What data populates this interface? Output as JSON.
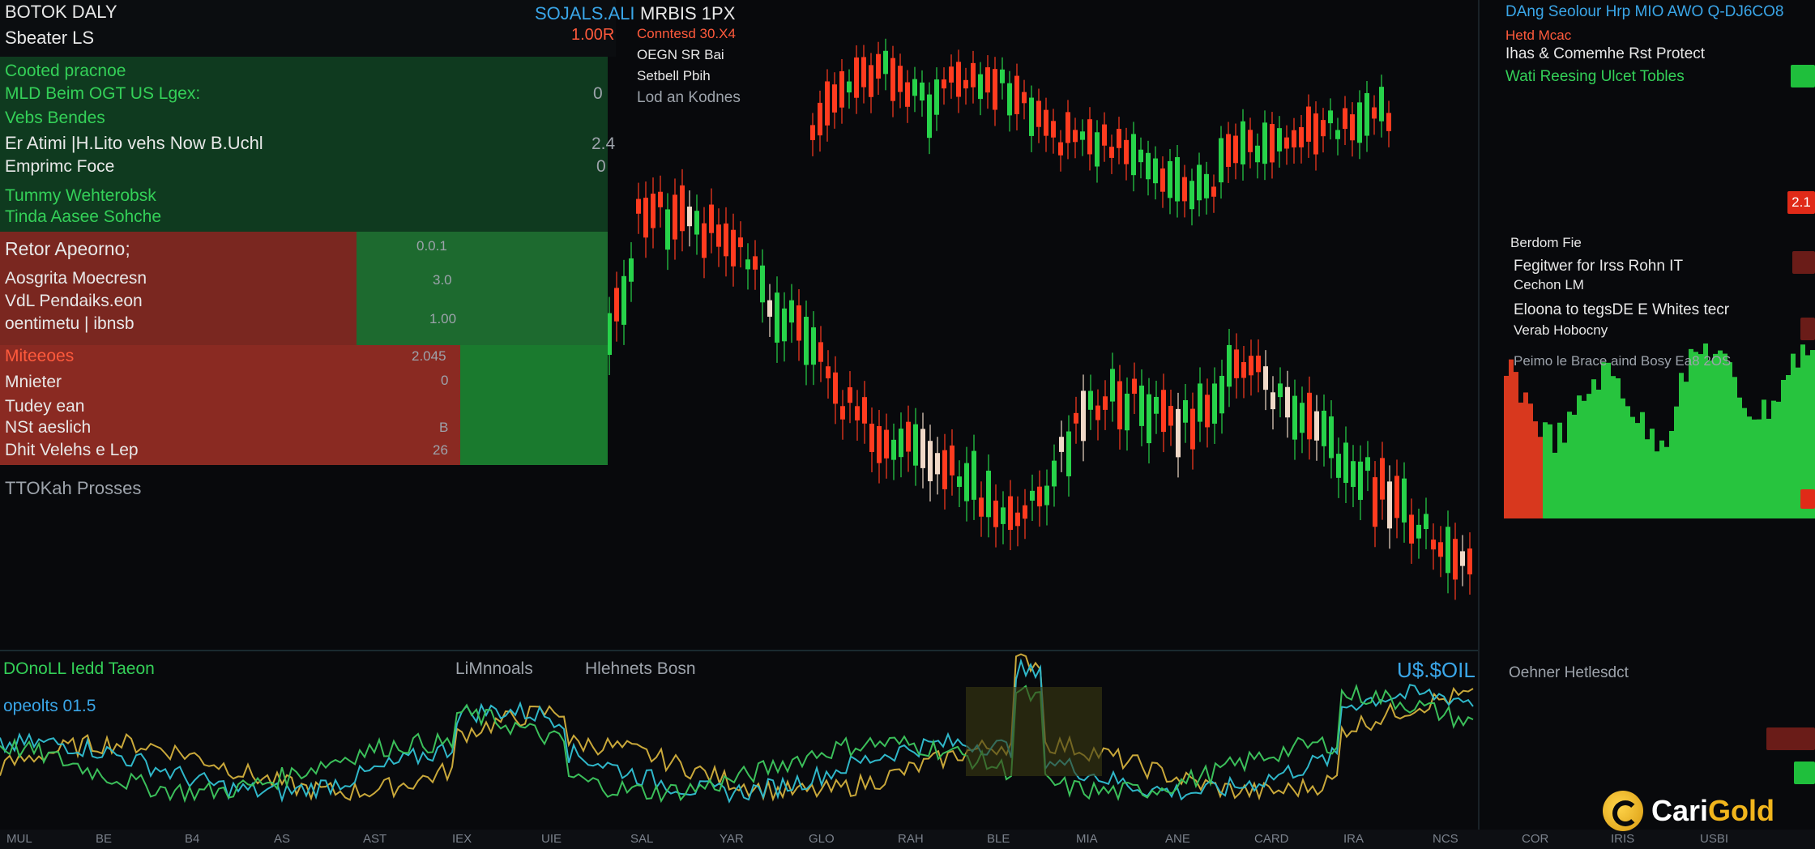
{
  "header": {
    "title": "BOTOK DALY",
    "subtitle": "Sbeater LS",
    "ticker_mid": "SOJALS.ALI",
    "ticker_mid2": "MRBIS 1PX",
    "value_top": "1.00R",
    "right_title": "DAng Seolour Hrp MIO AWO Q-DJ6CO8"
  },
  "top_info": [
    "Conntesd 30.X4",
    "OEGN SR Bai",
    "Setbell Pbih",
    "Lod an Kodnes"
  ],
  "watchlist": {
    "groups": [
      {
        "rows": [
          {
            "label": "Cooted pracnoe",
            "value": ""
          },
          {
            "label": "MLD Beim OGT US Lgex:",
            "value": "0"
          },
          {
            "label": "Vebs Bendes",
            "value": ""
          },
          {
            "label": "Er Atimi |H.Lito vehs Now B.Uchl",
            "value": "2.4"
          },
          {
            "label": "Emprimc Foce",
            "value": "0"
          },
          {
            "label": "Tummy Wehterobsk",
            "value": ""
          },
          {
            "label": "Tinda Aasee Sohche",
            "value": ""
          }
        ]
      },
      {
        "header": "Retor Apeorno;",
        "rows": [
          {
            "label": "Aosgrita Moecresn",
            "value": "3.0"
          },
          {
            "label": "VdL Pendaiks.eon",
            "value": ""
          },
          {
            "label": "oentimetu | ibnsb",
            "value": "1.00"
          }
        ],
        "header_value": "0.0.1"
      },
      {
        "header": "Miteeoes",
        "header_value": "2.045",
        "rows": [
          {
            "label": "Mnieter",
            "value": "0"
          },
          {
            "label": "Tudey ean",
            "value": ""
          },
          {
            "label": "NSt aeslich",
            "value": "B"
          },
          {
            "label": "Dhit Velehs e Lep",
            "value": "26"
          }
        ]
      }
    ],
    "footer": "TTOKah Prosses"
  },
  "right_panel": {
    "alert": "Hetd Mcac",
    "rows": [
      "Ihas & Comemhe Rst Protect",
      "Wati Reesing Ulcet Tobles",
      "Berdom Fie",
      "Fegitwer for Irss Rohn IT",
      "Cechon LM",
      "Eloona to tegsDE E Whites tecr",
      "Verab Hobocny",
      "Peimo le Brace aind Bosy Ea8 2OS"
    ],
    "badges": [
      "",
      "2.1",
      "",
      ""
    ],
    "lower_label": "Oehner Hetlesdct"
  },
  "lower_panel": {
    "title": "DOnoLL Iedd Taeon",
    "tab_a": "LiMnnoals",
    "tab_b": "Hlehnets Bosn",
    "value": "U$.$OIL",
    "indicator": "opeolts 01.5"
  },
  "axis_labels": [
    "MUL",
    "BE",
    "B4",
    "AS",
    "AST",
    "IEX",
    "UIE",
    "SAL",
    "YAR",
    "GLO",
    "RAH",
    "BLE",
    "MIA",
    "ANE",
    "CARD",
    "IRA",
    "NCS",
    "COR",
    "IRIS",
    "USBI"
  ],
  "brand": {
    "name_a": "Cari",
    "name_b": "Gold"
  },
  "colors": {
    "up": "#27d34a",
    "down": "#ff3b1f",
    "bg": "#08090c",
    "accent": "#3aa6e8"
  }
}
